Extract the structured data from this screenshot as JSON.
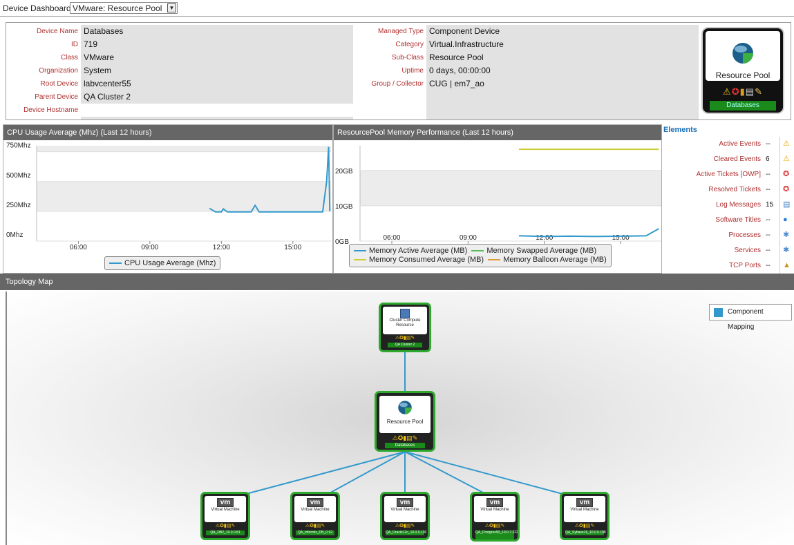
{
  "topbar": {
    "label": "Device Dashboard:",
    "selected": "VMware: Resource Pool"
  },
  "info_left": [
    {
      "key": "Device Name",
      "value": "Databases"
    },
    {
      "key": "ID",
      "value": "719"
    },
    {
      "key": "Class",
      "value": "VMware"
    },
    {
      "key": "Organization",
      "value": "System"
    },
    {
      "key": "Root Device",
      "value": "labvcenter55"
    },
    {
      "key": "Parent Device",
      "value": "QA Cluster 2"
    },
    {
      "key": "Device Hostname",
      "value": ""
    }
  ],
  "info_right": [
    {
      "key": "Managed Type",
      "value": "Component Device"
    },
    {
      "key": "Category",
      "value": "Virtual.Infrastructure"
    },
    {
      "key": "Sub-Class",
      "value": "Resource Pool"
    },
    {
      "key": "Uptime",
      "value": "0 days, 00:00:00"
    },
    {
      "key": "Group / Collector",
      "value": "CUG | em7_ao"
    }
  ],
  "device_badge": {
    "type": "Resource Pool",
    "name": "Databases"
  },
  "chart_data": [
    {
      "type": "line",
      "title": "CPU Usage Average (Mhz) (Last 12 hours)",
      "x_ticks": [
        "06:00",
        "09:00",
        "12:00",
        "15:00"
      ],
      "y_ticks": [
        "0Mhz",
        "250Mhz",
        "500Mhz",
        "750Mhz"
      ],
      "ylim": [
        0,
        800
      ],
      "series": [
        {
          "name": "CPU Usage Average (Mhz)",
          "color": "#3399cc",
          "x": [
            "11:30",
            "11:45",
            "12:00",
            "12:05",
            "12:15",
            "12:30",
            "13:15",
            "13:25",
            "13:35",
            "14:00",
            "15:00",
            "16:15",
            "16:25",
            "16:30",
            "16:33"
          ],
          "values": [
            275,
            245,
            245,
            270,
            245,
            245,
            245,
            300,
            245,
            245,
            245,
            245,
            500,
            790,
            250
          ]
        }
      ],
      "grid": true,
      "legend": "bottom"
    },
    {
      "type": "line",
      "title": "ResourcePool Memory Performance (Last 12 hours)",
      "x_ticks": [
        "06:00",
        "09:00",
        "12:00",
        "15:00"
      ],
      "y_ticks": [
        "0GB",
        "10GB",
        "20GB"
      ],
      "ylim": [
        0,
        27
      ],
      "series": [
        {
          "name": "Memory Active Average (MB)",
          "color": "#3399cc",
          "x": [
            "11:00",
            "12:00",
            "13:00",
            "14:00",
            "15:00",
            "16:00",
            "16:30"
          ],
          "values": [
            1.5,
            1.3,
            1.4,
            1.3,
            1.4,
            1.5,
            3.5
          ]
        },
        {
          "name": "Memory Swapped Average (MB)",
          "color": "#55bb55",
          "x": [],
          "values": []
        },
        {
          "name": "Memory Consumed Average (MB)",
          "color": "#cccc33",
          "x": [
            "11:00",
            "16:30"
          ],
          "values": [
            26,
            26
          ]
        },
        {
          "name": "Memory Balloon Average (MB)",
          "color": "#dd9933",
          "x": [],
          "values": []
        }
      ],
      "grid": true,
      "legend": "bottom"
    }
  ],
  "elements": {
    "title": "Elements",
    "rows": [
      {
        "name": "Active Events",
        "count": "--",
        "icon": "warning-icon"
      },
      {
        "name": "Cleared Events",
        "count": "6",
        "icon": "warning-icon"
      },
      {
        "name": "Active Tickets [OWP]",
        "count": "--",
        "icon": "lifebuoy-icon"
      },
      {
        "name": "Resolved Tickets",
        "count": "--",
        "icon": "lifebuoy-icon"
      },
      {
        "name": "Log Messages",
        "count": "15",
        "icon": "log-icon"
      },
      {
        "name": "Software Titles",
        "count": "--",
        "icon": "globe-icon"
      },
      {
        "name": "Processes",
        "count": "--",
        "icon": "gear-icon"
      },
      {
        "name": "Services",
        "count": "--",
        "icon": "gear-icon"
      },
      {
        "name": "TCP Ports",
        "count": "--",
        "icon": "port-icon"
      }
    ]
  },
  "topology": {
    "title": "Topology Map",
    "legend": "Component Mapping",
    "parent": {
      "type": "Cluster Compute Resource",
      "name": "QA Cluster 2"
    },
    "center": {
      "type": "Resource Pool",
      "name": "Databases"
    },
    "vms": [
      {
        "type": "Virtual Machine",
        "name": "QA_DB2_10.0.0.81"
      },
      {
        "type": "Virtual Machine",
        "name": "QA_Informix_DB_0.92"
      },
      {
        "type": "Virtual Machine",
        "name": "QA_Oracle12c_10.0.0.136"
      },
      {
        "type": "Virtual Machine",
        "name": "QA_Postgres90_10.0.7.222"
      },
      {
        "type": "Virtual Machine",
        "name": "QA_Sybase16_10.0.0.198"
      }
    ]
  },
  "colors": {
    "accent": "#3399cc",
    "badge_green": "#2fa82f",
    "label_red": "#b03030"
  }
}
